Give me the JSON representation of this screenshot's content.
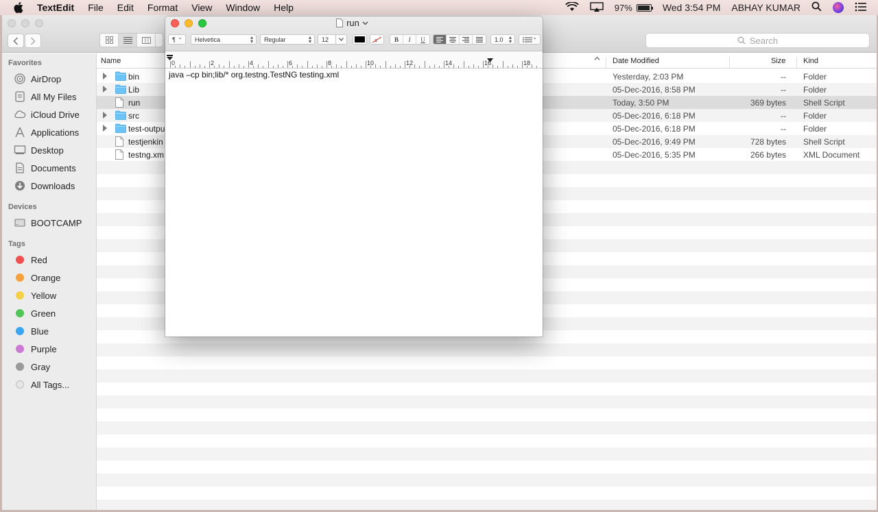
{
  "menubar": {
    "app_name": "TextEdit",
    "menus": [
      "File",
      "Edit",
      "Format",
      "View",
      "Window",
      "Help"
    ],
    "battery_percent": "97%",
    "battery_level": 0.97,
    "clock": "Wed 3:54 PM",
    "user": "ABHAY KUMAR",
    "icons": [
      "apple-icon",
      "wifi-icon",
      "airplay-icon",
      "battery-icon",
      "search-icon",
      "siri-icon",
      "notification-list-icon"
    ]
  },
  "finder": {
    "search_placeholder": "Search",
    "sidebar": {
      "favorites_heading": "Favorites",
      "favorites": [
        "AirDrop",
        "All My Files",
        "iCloud Drive",
        "Applications",
        "Desktop",
        "Documents",
        "Downloads"
      ],
      "devices_heading": "Devices",
      "devices": [
        "BOOTCAMP"
      ],
      "tags_heading": "Tags",
      "tags": [
        {
          "label": "Red",
          "color": "#f0514f"
        },
        {
          "label": "Orange",
          "color": "#f6a13b"
        },
        {
          "label": "Yellow",
          "color": "#f5cf47"
        },
        {
          "label": "Green",
          "color": "#4fc657"
        },
        {
          "label": "Blue",
          "color": "#3aa6f4"
        },
        {
          "label": "Purple",
          "color": "#cc7ad6"
        },
        {
          "label": "Gray",
          "color": "#9a9a9a"
        },
        {
          "label": "All Tags...",
          "color": "#e6e6e6"
        }
      ]
    },
    "columns": {
      "name": "Name",
      "date": "Date Modified",
      "size": "Size",
      "kind": "Kind"
    },
    "files": [
      {
        "name": "bin",
        "date": "Yesterday, 2:03 PM",
        "size": "--",
        "kind": "Folder",
        "folder": true,
        "selected": false
      },
      {
        "name": "Lib",
        "date": "05-Dec-2016, 8:58 PM",
        "size": "--",
        "kind": "Folder",
        "folder": true,
        "selected": false
      },
      {
        "name": "run",
        "date": "Today, 3:50 PM",
        "size": "369 bytes",
        "kind": "Shell Script",
        "folder": false,
        "selected": true
      },
      {
        "name": "src",
        "date": "05-Dec-2016, 6:18 PM",
        "size": "--",
        "kind": "Folder",
        "folder": true,
        "selected": false
      },
      {
        "name": "test-outpu",
        "date": "05-Dec-2016, 6:18 PM",
        "size": "--",
        "kind": "Folder",
        "folder": true,
        "selected": false
      },
      {
        "name": "testjenkin",
        "date": "05-Dec-2016, 9:49 PM",
        "size": "728 bytes",
        "kind": "Shell Script",
        "folder": false,
        "selected": false
      },
      {
        "name": "testng.xm",
        "date": "05-Dec-2016, 5:35 PM",
        "size": "266 bytes",
        "kind": "XML Document",
        "folder": false,
        "selected": false
      }
    ]
  },
  "textedit": {
    "title": "run",
    "paragraph_symbol": "¶",
    "font_family": "Helvetica",
    "font_style": "Regular",
    "font_size": "12",
    "text_color": "#000000",
    "bold": "B",
    "italic": "I",
    "underline": "U",
    "line_spacing": "1.0",
    "ruler_labels": [
      "0",
      "2",
      "4",
      "6",
      "8",
      "10",
      "12",
      "14",
      "16",
      "18"
    ],
    "content": "java –cp bin;lib/* org.testng.TestNG testing.xml"
  }
}
